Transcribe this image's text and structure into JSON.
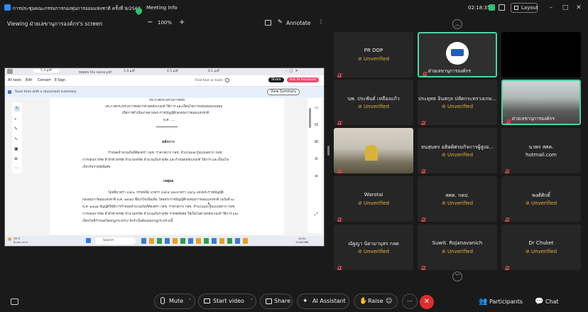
{
  "window": {
    "title": "การประชุมคณะกรรมการกองทุนการออมแห่งชาติ ครั้งที่ 9/2568",
    "meeting_info": "Meeting Info",
    "clock": "02:18:35",
    "layout_label": "Layout"
  },
  "toolbar": {
    "viewing": "Viewing ฝ่ายเลขานุการองค์กร's screen",
    "zoom": "100%",
    "annotate": "Annotate"
  },
  "pdf": {
    "tabs": [
      "5.3.pdf",
      "ทดสอบ File name.pdf",
      "5.4.pdf",
      "4.5.pdf",
      "6.1.pdf"
    ],
    "menu": [
      "All tools",
      "Edit",
      "Convert",
      "E-Sign"
    ],
    "find_placeholder": "Find text or tools",
    "share": "Share",
    "ask_ai": "Ask AI Assistant",
    "banner": "Save time with a document summary.",
    "view_summary": "View Summary",
    "doc": {
      "line1": "ประกาศกระทรวงการคลัง",
      "line2": "ประกาศกระทรวงการคลังว่าด้วยหลักเกณฑ์ วิธีการ และเงื่อนไขการลงทุนของกองทุน",
      "line3": "เพื่อการดำเนินงานตามพระราชบัญญัติกองทุนการออมแห่งชาติ",
      "line4": "พ.ศ. ....",
      "heading1": "หลักการ",
      "para1a": "กำหนดจำนวนเงินที่ต้องตรา กอช. ราคาสถาก กอช. จำนวนและรูปแบบสถาก กอช.",
      "para1b": "การถอนการจัด สำลำตัวจรจัด จำนวนจรจัด จำนวนเงินรายจัด และกำหนดหลักเกณฑ์ วิธีการ และเงื่อนไข",
      "para1c": "เกี่ยวกับรายจัดพิเศษ",
      "heading2": "เหตุผล",
      "para2a": "โดยที่มาตรา ๔๕/๓ วรรคหนึ่ง มาตรา ๔๕/๕ และมาตรา ๔๕/๖ แห่งพระราชบัญญัติ",
      "para2b": "กองทุนการออมแห่งชาติ พ.ศ. ๒๕๕๔ ซึ่งแก้ไขเพิ่มเติม โดยพระราชบัญญัติกองทุนการออมแห่งชาติ (ฉบับที่ ๒)",
      "para2c": "พ.ศ. ๒๕๖๑ บัญญัติให้มีการกำหนดจำนวนเงินที่ต้องตรา กอช. ราคาสถาก กอช. จำนวนและรูปแบบสถาก กอช.",
      "para2d": "การถอนการจัด สำลำตัวจรจัด จำนวนจรจัด จำนวนเงินรายจัด รายจัดพิเศษ ให้เป็นไปตามหลักเกณฑ์ วิธีการ และ",
      "para2e": "เงื่อนไขที่กำหนดโดยกฎกระทรวง จึงจำเป็นต้องออกกฎกระทรวงนี้"
    },
    "taskbar": {
      "temp": "35°C",
      "weather": "มีเมฆบางส่วน",
      "search": "Search",
      "time": "14:51",
      "date": "11/9/2568"
    }
  },
  "participants": [
    {
      "name": "PR DOP",
      "status": "Unverified",
      "type": "name"
    },
    {
      "name": "ฝ่ายเลขานุการองค์กร",
      "status": "",
      "type": "logo"
    },
    {
      "name": "",
      "status": "",
      "type": "black"
    },
    {
      "name": "นพ. ประพันธ์ เหลืองแก้ว",
      "status": "Unverified",
      "type": "name"
    },
    {
      "name": "ประยุทธ อินสกุล ปลัดกระทรวงเกษ...",
      "status": "Unverified",
      "type": "name"
    },
    {
      "name": "ฝ่ายเลขานุการองค์กร",
      "status": "",
      "type": "room"
    },
    {
      "name": "",
      "status": "",
      "type": "video"
    },
    {
      "name": "ธนสุนทร อธิษดิศรมกิจการผู้สูงอ...",
      "status": "Unverified",
      "type": "name"
    },
    {
      "name": "นวพร สศค.",
      "status": "hotmail.com",
      "type": "name"
    },
    {
      "name": "Warotai",
      "status": "Unverified",
      "type": "name"
    },
    {
      "name": "สศค. กคป.",
      "status": "Unverified",
      "type": "name"
    },
    {
      "name": "พงศ์ศักดิ์",
      "status": "Unverified",
      "type": "name"
    },
    {
      "name": "ณัฐญา นิยามาบุสร กลต",
      "status": "Unverified",
      "type": "name"
    },
    {
      "name": "Suwit. Rojanavanich",
      "status": "Unverified",
      "type": "name"
    },
    {
      "name": "Dr Chuket",
      "status": "Unverified",
      "type": "name"
    }
  ],
  "controls": {
    "mute": "Mute",
    "start_video": "Start video",
    "share": "Share",
    "ai_assistant": "AI Assistant",
    "raise": "Raise",
    "participants": "Participants",
    "chat": "Chat"
  },
  "colors": {
    "accent_green": "#3ecf8e",
    "unverified": "#e5b33a",
    "end_red": "#e02d2d",
    "active_border": "#4fd1a5"
  }
}
